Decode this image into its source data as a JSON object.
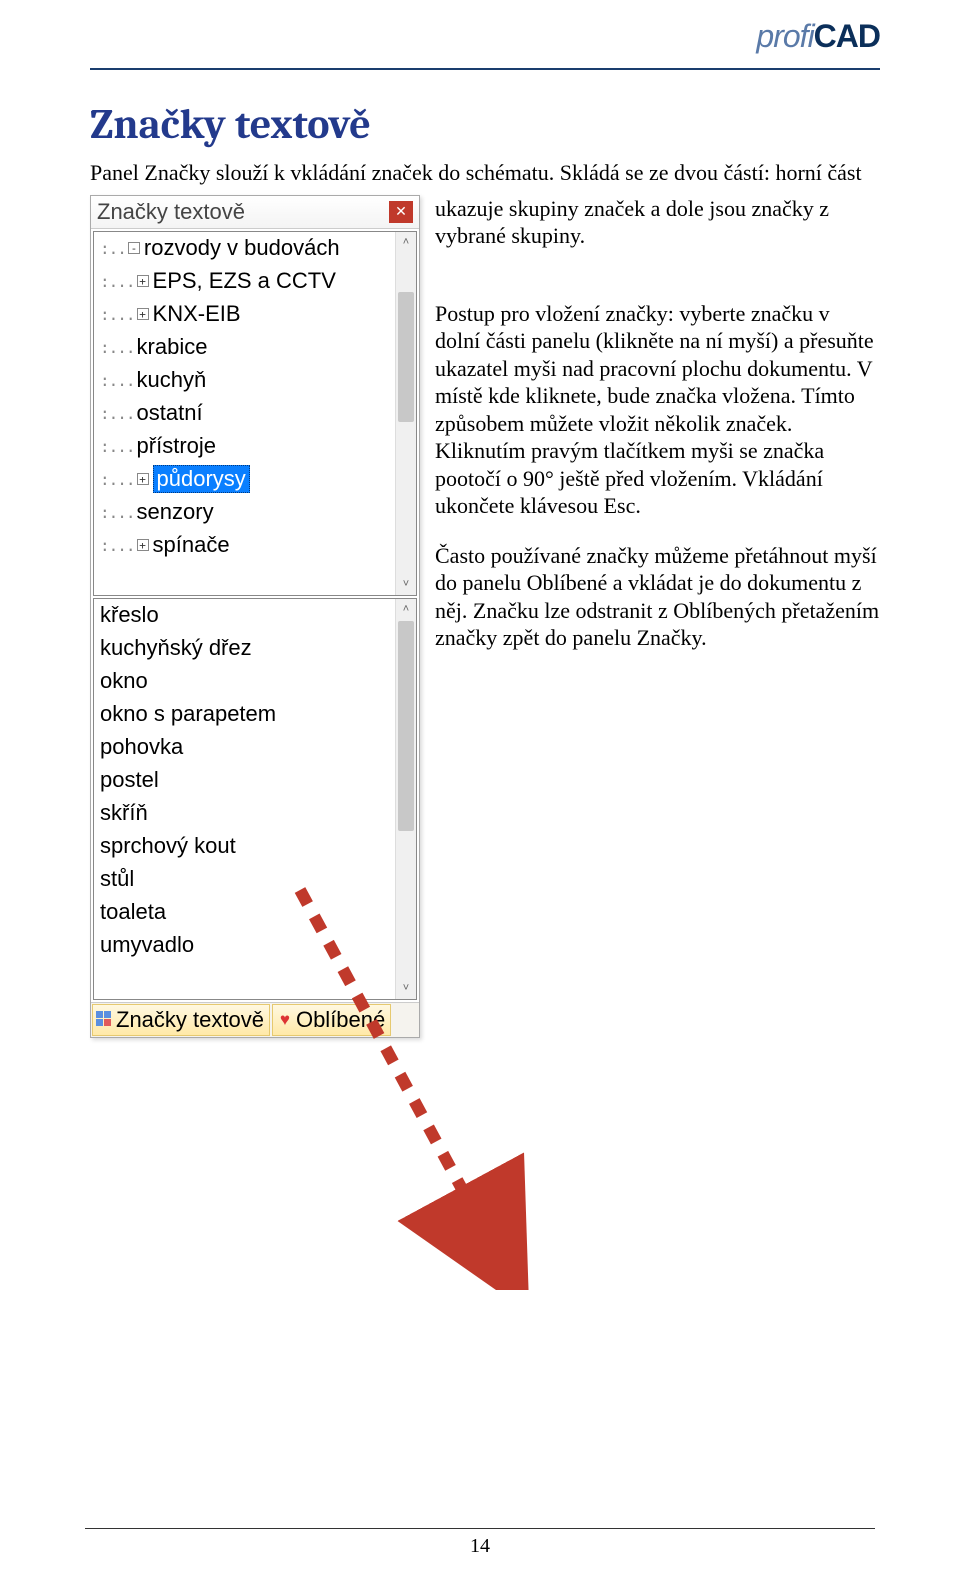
{
  "logo": {
    "part1": "profi",
    "part2": "CAD"
  },
  "heading": "Značky textově",
  "intro_line1": "Panel Značky slouží k vkládání značek do schématu. Skládá se ze dvou částí: horní část",
  "intro_cont": "ukazuje skupiny značek a dole jsou značky z vybrané skupiny.",
  "panel_title": "Značky textově",
  "close_glyph": "✕",
  "tree": [
    {
      "label": "rozvody v budovách",
      "exp": "-",
      "lvl": 0
    },
    {
      "label": "EPS, EZS a CCTV",
      "exp": "+",
      "lvl": 1
    },
    {
      "label": "KNX-EIB",
      "exp": "+",
      "lvl": 1
    },
    {
      "label": "krabice",
      "exp": "",
      "lvl": 1
    },
    {
      "label": "kuchyň",
      "exp": "",
      "lvl": 1
    },
    {
      "label": "ostatní",
      "exp": "",
      "lvl": 1
    },
    {
      "label": "přístroje",
      "exp": "",
      "lvl": 1
    },
    {
      "label": "půdorysy",
      "exp": "+",
      "lvl": 1,
      "selected": true
    },
    {
      "label": "senzory",
      "exp": "",
      "lvl": 1
    },
    {
      "label": "spínače",
      "exp": "+",
      "lvl": 1
    }
  ],
  "list": [
    "křeslo",
    "kuchyňský dřez",
    "okno",
    "okno s parapetem",
    "pohovka",
    "postel",
    "skříň",
    "sprchový kout",
    "stůl",
    "toaleta",
    "umyvadlo"
  ],
  "tabs": [
    {
      "label": "Značky textově",
      "icon": "thumbnails"
    },
    {
      "label": "Oblíbené",
      "icon": "heart"
    }
  ],
  "body_para1": "Postup pro vložení značky: vyberte značku v dolní části panelu (klikněte na ní myší) a přesuňte ukazatel myši nad pracovní plochu dokumentu. V místě kde kliknete, bude značka vložena. Tímto způsobem můžete vložit několik značek. Kliknutím pravým tlačítkem myši se značka pootočí o 90° ještě před vložením. Vkládání ukončete klávesou Esc.",
  "body_para2": "Často používané značky můžeme přetáhnout myší do panelu Oblíbené a vkládat je do dokumentu z něj. Značku lze odstranit z Oblíbených přetažením značky zpět do panelu Značky.",
  "scroll_up": "˄",
  "scroll_down": "˅",
  "page_number": "14"
}
